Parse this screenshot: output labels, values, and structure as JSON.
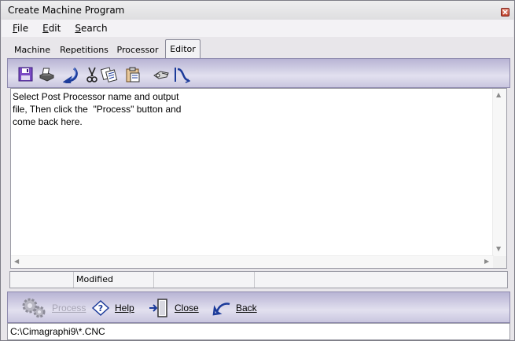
{
  "window": {
    "title": "Create Machine Program"
  },
  "menu": {
    "file": {
      "accel": "F",
      "rest": "ile"
    },
    "edit": {
      "accel": "E",
      "rest": "dit"
    },
    "search": {
      "accel": "S",
      "rest": "earch"
    }
  },
  "tabs": [
    "Machine",
    "Repetitions",
    "Processor",
    "Editor"
  ],
  "active_tab": "Editor",
  "toolbar": {
    "icons": [
      "save-icon",
      "print-icon",
      "undo-icon",
      "cut-icon",
      "copy-icon",
      "paste-icon",
      "find-icon",
      "find-next-icon"
    ]
  },
  "editor": {
    "text": "Select Post Processor name and output\nfile, Then click the  \"Process\" button and\ncome back here.\n"
  },
  "status": {
    "modified": "Modified"
  },
  "buttons": {
    "process": "Process",
    "help": "Help",
    "close": "Close",
    "back": "Back"
  },
  "path": "C:\\Cimagraphi9\\*.CNC",
  "colors": {
    "accent_blue": "#1c3b9a",
    "bar_purple": "#c9c6df"
  }
}
